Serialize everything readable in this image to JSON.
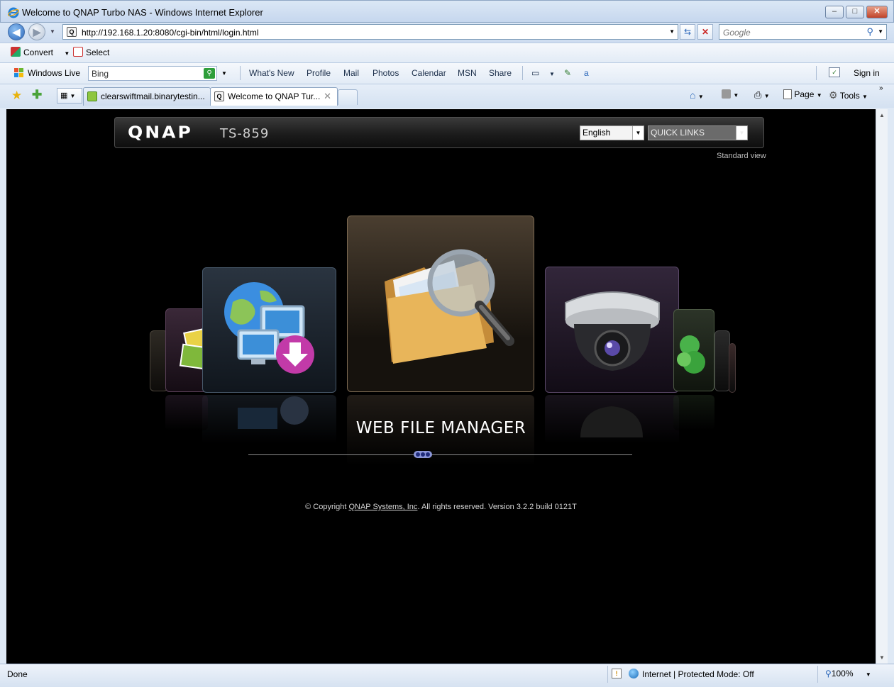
{
  "window": {
    "title": "Welcome to QNAP Turbo NAS - Windows Internet Explorer",
    "minimize": "–",
    "maximize": "□",
    "close": "✕"
  },
  "address_bar": {
    "url": "http://192.168.1.20:8080/cgi-bin/html/login.html",
    "search_placeholder": "Google"
  },
  "command_bar": {
    "convert_label": "Convert",
    "select_label": "Select"
  },
  "live_toolbar": {
    "brand_label": "Windows Live",
    "search_value": "Bing",
    "links": [
      "What's New",
      "Profile",
      "Mail",
      "Photos",
      "Calendar",
      "MSN",
      "Share"
    ],
    "sign_in_label": "Sign in"
  },
  "tabs": [
    {
      "label": "clearswiftmail.binarytestin...",
      "active": false
    },
    {
      "label": "Welcome to QNAP Tur...",
      "active": true
    }
  ],
  "tab_toolbar": {
    "page_label": "Page",
    "tools_label": "Tools"
  },
  "page": {
    "logo": "QNAP",
    "model": "TS-859",
    "language_select": "English",
    "quick_links_select": "QUICK LINKS",
    "standard_view_link": "Standard view",
    "carousel_title": "WEB FILE MANAGER",
    "carousel_items": [
      "photo-station-icon",
      "download-station-icon",
      "web-file-manager-icon",
      "surveillance-camera-icon",
      "multimedia-station-icon"
    ],
    "copyright_prefix": "© Copyright ",
    "copyright_link": "QNAP Systems, Inc",
    "copyright_suffix": ". All rights reserved. Version 3.2.2 build 0121T"
  },
  "status_bar": {
    "status": "Done",
    "zone": "Internet | Protected Mode: Off",
    "zoom": "100%"
  }
}
